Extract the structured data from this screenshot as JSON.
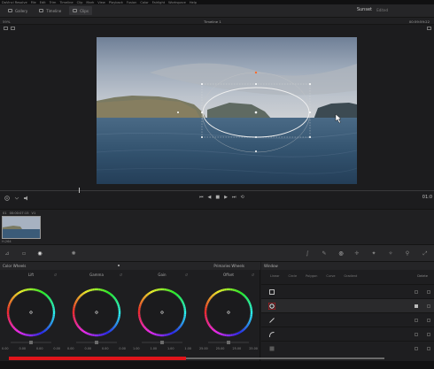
{
  "menubar": {
    "items": [
      "DaVinci Resolve",
      "File",
      "Edit",
      "Trim",
      "Timeline",
      "Clip",
      "Mark",
      "View",
      "Playback",
      "Fusion",
      "Color",
      "Fairlight",
      "Workspace",
      "Help"
    ]
  },
  "toolbar": {
    "gallery": "Gallery",
    "timeline": "Timeline",
    "clips": "Clips",
    "project": "Sunset",
    "page": "Edited"
  },
  "viewer": {
    "zoom": "59%",
    "timeline_name": "Timeline 1",
    "timecode": "00:59:59:22"
  },
  "transport": {
    "timecode": "01:0"
  },
  "clips": {
    "clip_number": "01",
    "clip_timecode": "00:00:07:15",
    "clip_track": "V1",
    "codec": "H.264"
  },
  "color_wheels": {
    "title": "Color Wheels",
    "mode": "Primaries Wheels",
    "wheels": [
      {
        "label": "Lift",
        "values": [
          "0.00",
          "0.00",
          "0.00",
          "0.00"
        ]
      },
      {
        "label": "Gamma",
        "values": [
          "0.00",
          "0.00",
          "0.00",
          "0.00"
        ]
      },
      {
        "label": "Gain",
        "values": [
          "1.00",
          "1.00",
          "1.00",
          "1.00"
        ]
      },
      {
        "label": "Offset",
        "values": [
          "25.00",
          "25.00",
          "25.00",
          "25.00"
        ]
      }
    ]
  },
  "window_panel": {
    "title": "Window",
    "tools": [
      "Linear",
      "Circle",
      "Polygon",
      "Curve",
      "Gradient"
    ],
    "delete": "Delete",
    "shapes": [
      "square-icon",
      "circle-window-icon",
      "pen-line-icon",
      "curve-icon",
      "gradient-icon"
    ]
  },
  "colors": {
    "accent_red": "#e0141a",
    "background": "#1c1c1e"
  }
}
